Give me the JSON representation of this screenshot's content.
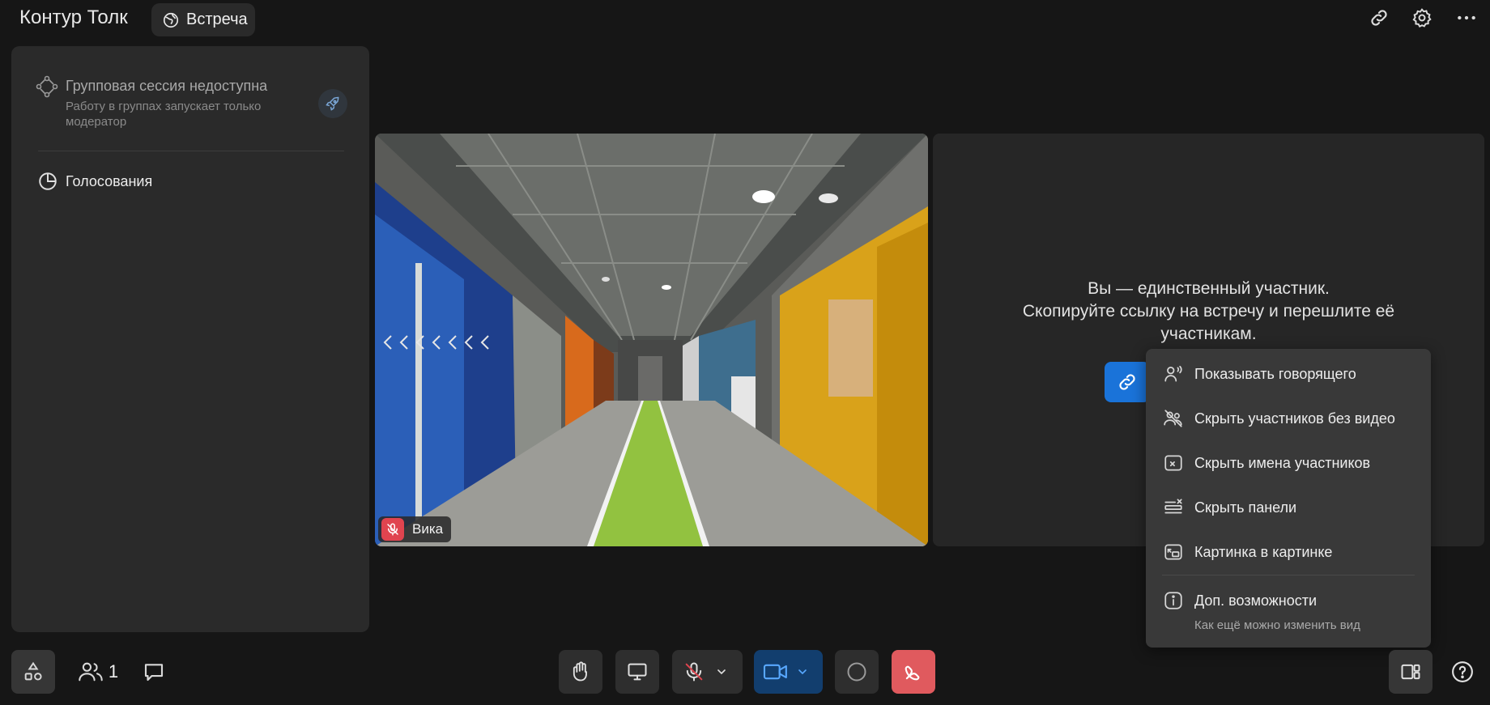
{
  "header": {
    "app_title": "Контур Толк",
    "meeting_badge": "Встреча",
    "icons": [
      "link-icon",
      "gear-icon",
      "more-icon"
    ]
  },
  "left_panel": {
    "group_session_title": "Групповая сессия недоступна",
    "group_session_subtitle": "Работу в группах запускает только модератор",
    "polls_label": "Голосования"
  },
  "video": {
    "participant_name": "Вика",
    "mic_muted": true
  },
  "empty_tile": {
    "line1": "Вы — единственный участник.",
    "line2": "Скопируйте ссылку на встречу и перешлите её",
    "line3": "участникам."
  },
  "view_menu": {
    "items": [
      {
        "label": "Показывать говорящего",
        "icon": "speaker-icon"
      },
      {
        "label": "Скрыть участников без видео",
        "icon": "hide-users-icon"
      },
      {
        "label": "Скрыть имена участников",
        "icon": "hide-names-icon"
      },
      {
        "label": "Скрыть панели",
        "icon": "hide-panels-icon"
      },
      {
        "label": "Картинка в картинке",
        "icon": "pip-icon"
      }
    ],
    "extra_title": "Доп. возможности",
    "extra_subtitle": "Как ещё можно изменить вид"
  },
  "toolbar": {
    "participants_count": "1",
    "colors": {
      "camera_active": "#123e6e",
      "hangup": "#e05a5e",
      "accent": "#1a73d9",
      "mic_off": "#e0444f"
    }
  }
}
